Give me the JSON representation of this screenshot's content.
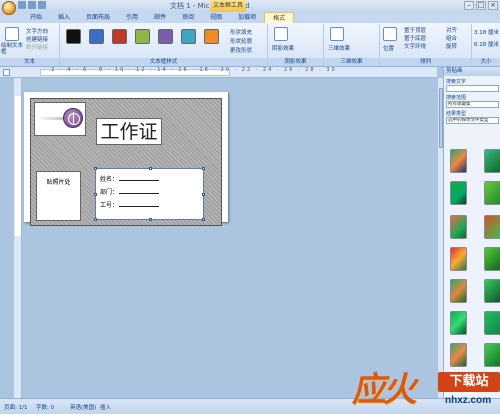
{
  "window": {
    "title": "文档 1 - Microsoft Word",
    "context_tools": "文本框工具"
  },
  "tabs": [
    "开始",
    "插入",
    "页面布局",
    "引用",
    "邮件",
    "审阅",
    "视图",
    "加载项",
    "格式"
  ],
  "ribbon": {
    "text_group": {
      "label": "文本",
      "draw_textbox": "绘制文本框",
      "text_direction": "文字方向",
      "create_link": "创建链接",
      "break_link": "断开链接"
    },
    "styles_group": {
      "label": "文本框样式",
      "fill": "形状填充",
      "outline": "形状轮廓",
      "change_shape": "更改形状"
    },
    "shadow_group": {
      "label": "阴影效果",
      "btn": "阴影效果"
    },
    "threed_group": {
      "label": "三维效果",
      "btn": "三维效果"
    },
    "arrange_group": {
      "label": "排列",
      "position": "位置",
      "bring_front": "置于顶层",
      "send_back": "置于底层",
      "wrap": "文字环绕",
      "align": "对齐",
      "group": "组合",
      "rotate": "旋转"
    },
    "size_group": {
      "label": "大小",
      "height": "3.18 厘米",
      "width": "6.18 厘米"
    },
    "swatch_colors": [
      "#111111",
      "#3b6fc4",
      "#c0392b",
      "#8db54a",
      "#7b5ea7",
      "#3ea6c2",
      "#f08a24"
    ]
  },
  "document": {
    "card_title": "工作证",
    "photo_label": "贴照片处",
    "field_name": "姓名：",
    "field_dept": "部门：",
    "field_id": "工号："
  },
  "clipart_pane": {
    "title": "剪贴画",
    "search_label": "搜索文字",
    "search_in_label": "搜索范围",
    "search_in_value": "所有收藏集",
    "results_label": "结果类型",
    "results_value": "选中的媒体文件类型"
  },
  "statusbar": {
    "page": "页面: 1/1",
    "words": "字数: 0",
    "language": "英语(美国)",
    "mode": "插入"
  },
  "watermark": {
    "brand": "应火",
    "site": "下载站",
    "url": "nhxz.com"
  }
}
